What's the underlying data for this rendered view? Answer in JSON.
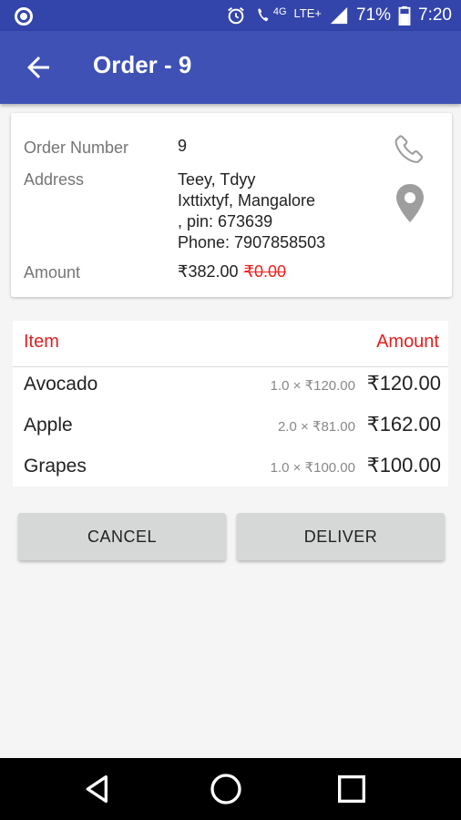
{
  "status_bar": {
    "network": "4G",
    "lte": "LTE+",
    "battery": "71%",
    "time": "7:20",
    "icons": [
      "circle-icon",
      "alarm-icon",
      "wifi-call-icon",
      "signal-icon",
      "battery-icon"
    ]
  },
  "app_bar": {
    "title": "Order - 9",
    "back_icon": "arrow-back-icon"
  },
  "order": {
    "number_label": "Order Number",
    "number": "9",
    "address_label": "Address",
    "address_line1": "Teey, Tdyy",
    "address_line2": "Ixttixtyf, Mangalore",
    "address_line3": ", pin: 673639",
    "phone": "Phone: 7907858503",
    "amount_label": "Amount",
    "amount": "₹382.00",
    "amount_struck": "₹0.00",
    "call_icon": "phone-icon",
    "map_icon": "location-pin-icon"
  },
  "items": {
    "col_item": "Item",
    "col_amount": "Amount",
    "rows": [
      {
        "name": "Avocado",
        "qty": "1.0 × ₹120.00",
        "amount": "₹120.00"
      },
      {
        "name": "Apple",
        "qty": "2.0 × ₹81.00",
        "amount": "₹162.00"
      },
      {
        "name": "Grapes",
        "qty": "1.0 × ₹100.00",
        "amount": "₹100.00"
      }
    ]
  },
  "actions": {
    "cancel": "CANCEL",
    "deliver": "DELIVER"
  },
  "nav": [
    "back-triangle-icon",
    "home-circle-icon",
    "recents-square-icon"
  ],
  "colors": {
    "status_bar": "#3344aa",
    "app_bar": "#3f51b5",
    "accent_red": "#e02020",
    "button_bg": "#d6d7d7"
  }
}
